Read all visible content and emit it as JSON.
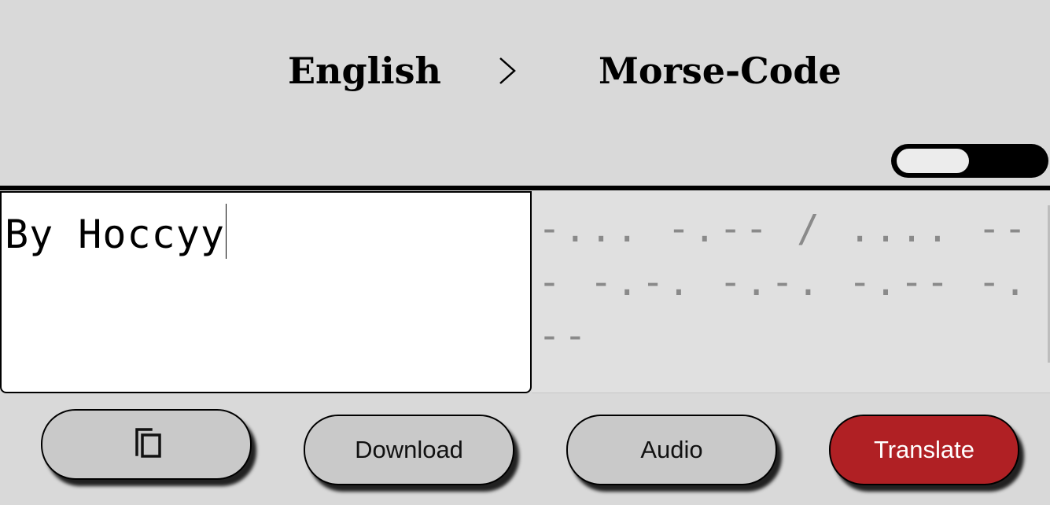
{
  "header": {
    "source_language": "English",
    "target_language": "Morse-Code",
    "swap_icon": "chevron-right-icon"
  },
  "toggle": {
    "state": "off"
  },
  "input": {
    "value": "By Hoccyy"
  },
  "output": {
    "value": "-... -.-- / .... --- -.-. -.-. -.-- -.--"
  },
  "buttons": {
    "copy_icon": "copy-icon",
    "download_label": "Download",
    "audio_label": "Audio",
    "translate_label": "Translate"
  },
  "colors": {
    "background": "#d9d9d9",
    "translate_button": "#b02024",
    "output_text": "#8a8a8a"
  }
}
